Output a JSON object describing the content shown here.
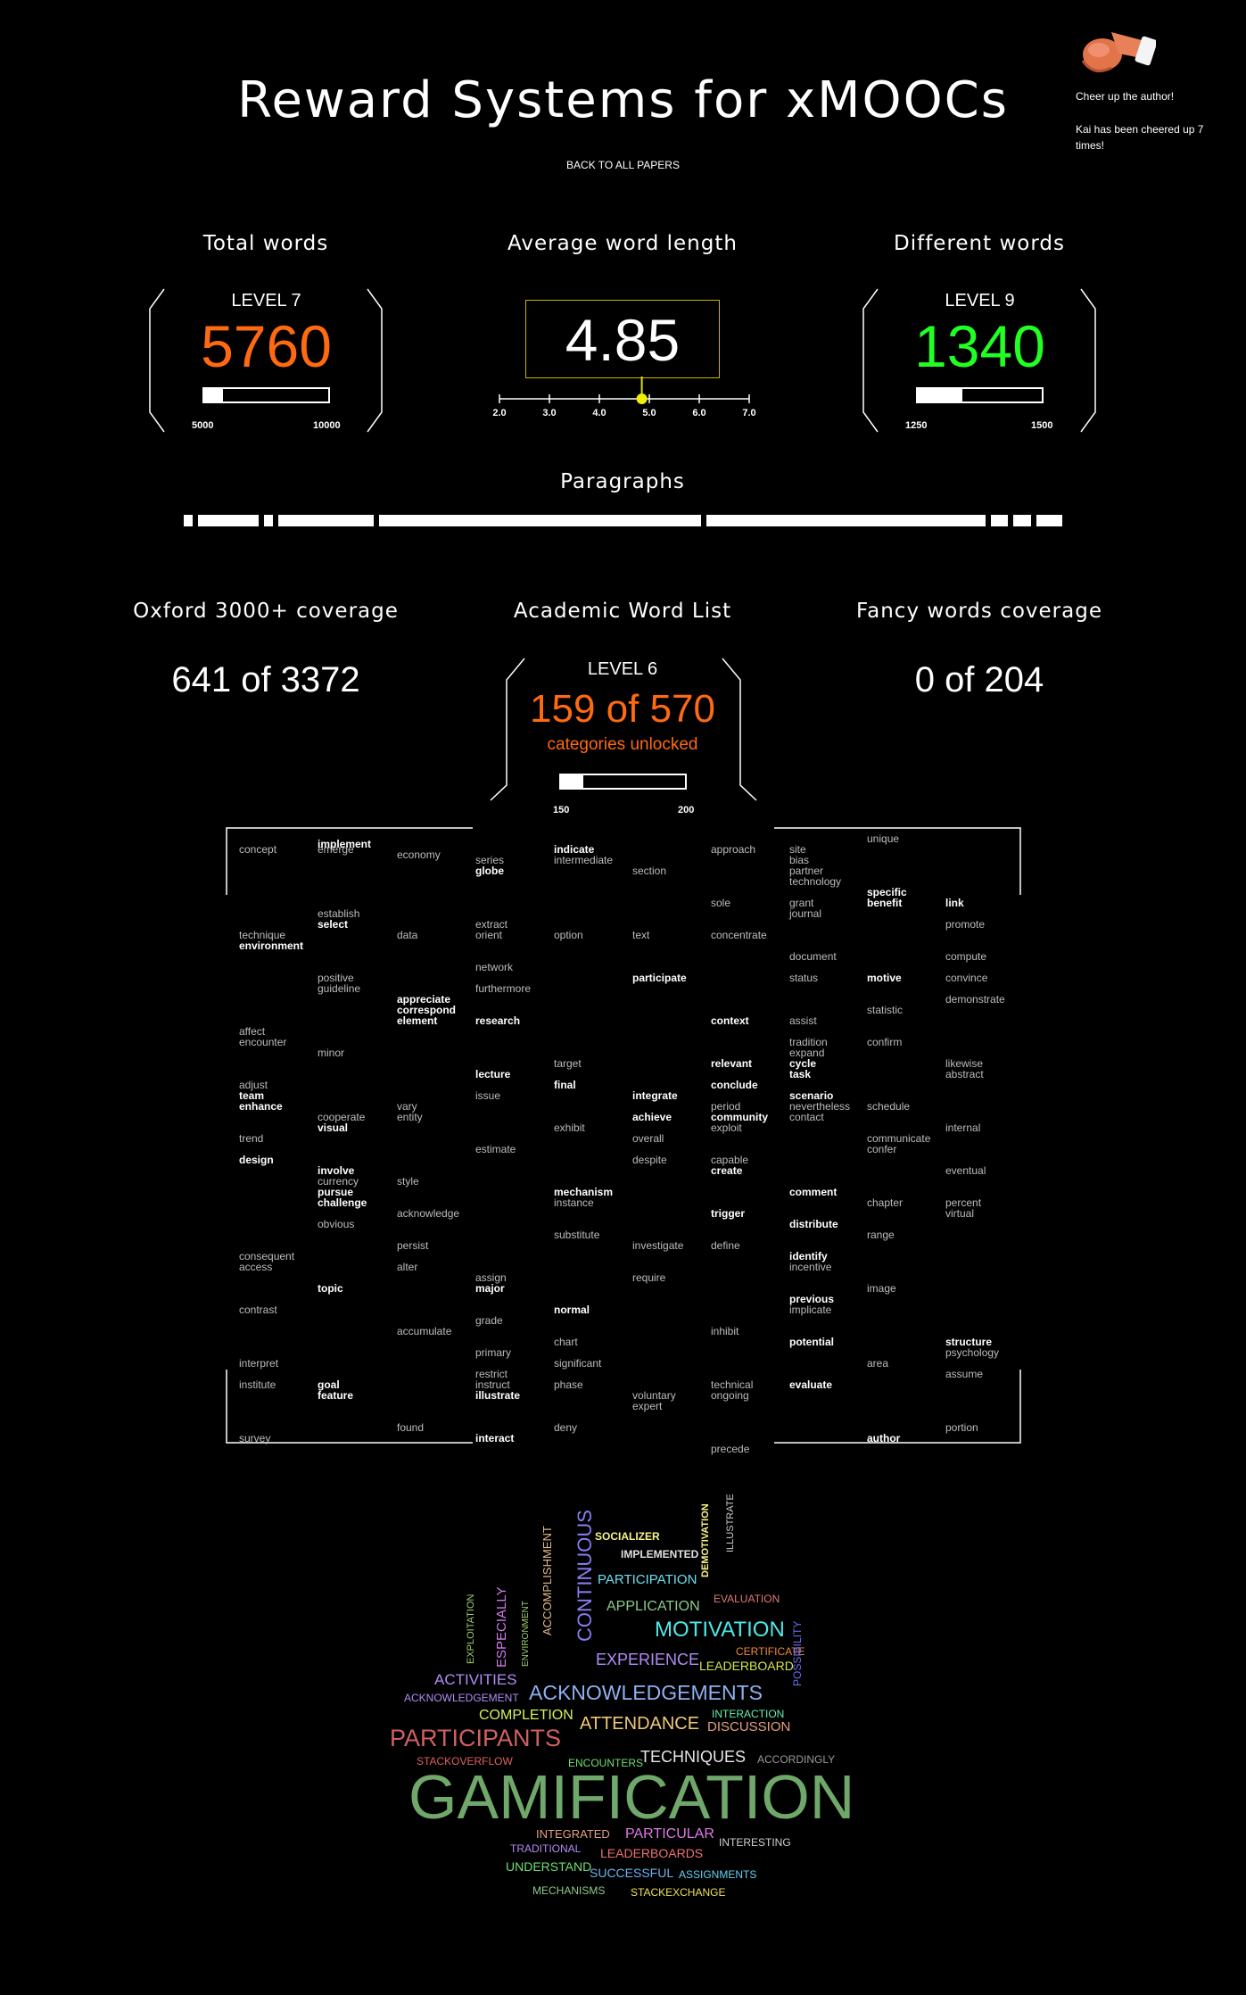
{
  "page": {
    "title": "Reward Systems for xMOOCs",
    "back_link": "BACK TO ALL PAPERS",
    "cheer_label": "Cheer up the author!",
    "cheer_count": "Kai has been cheered up 7 times!"
  },
  "stats": {
    "total_words": {
      "title": "Total words",
      "level": "LEVEL 7",
      "value": "5760",
      "min": "5000",
      "max": "10000",
      "fill": 0.15,
      "color": "#ff6a10"
    },
    "avg_word_length": {
      "title": "Average word length",
      "value": "4.85",
      "ticks": [
        "2.0",
        "3.0",
        "4.0",
        "5.0",
        "6.0",
        "7.0"
      ],
      "marker": 4.85
    },
    "different_words": {
      "title": "Different words",
      "level": "LEVEL 9",
      "value": "1340",
      "min": "1250",
      "max": "1500",
      "fill": 0.36,
      "color": "#22ff22"
    }
  },
  "paragraphs": {
    "title": "Paragraphs",
    "relative_lengths": [
      1,
      7,
      1,
      11,
      37,
      32,
      2,
      2,
      3
    ]
  },
  "coverage": {
    "oxford": {
      "title": "Oxford 3000+ coverage",
      "value": "641 of 3372"
    },
    "awl": {
      "title": "Academic Word List",
      "level": "LEVEL 6",
      "value": "159 of 570",
      "sub": "categories unlocked",
      "min": "150",
      "max": "200",
      "fill": 0.18,
      "color": "#ff6a10"
    },
    "fancy": {
      "title": "Fancy words coverage",
      "value": "0 of 204"
    }
  },
  "word_grid": [
    [
      "concept",
      "",
      0,
      0
    ],
    [
      "implement",
      "hi",
      1,
      -0.5
    ],
    [
      "emerge",
      "",
      1,
      0
    ],
    [
      "economy",
      "",
      2,
      0.5
    ],
    [
      "series",
      "",
      3,
      1
    ],
    [
      "globe",
      "hi",
      3,
      2
    ],
    [
      "indicate",
      "hi",
      4,
      0
    ],
    [
      "intermediate",
      "",
      4,
      1
    ],
    [
      "section",
      "",
      5,
      2
    ],
    [
      "approach",
      "",
      6,
      0
    ],
    [
      "site",
      "",
      7,
      0
    ],
    [
      "bias",
      "",
      7,
      1
    ],
    [
      "partner",
      "",
      7,
      2
    ],
    [
      "technology",
      "",
      7,
      3
    ],
    [
      "unique",
      "",
      8,
      -1
    ],
    [
      "specific",
      "hi",
      8,
      4
    ],
    [
      "benefit",
      "hi",
      8,
      5
    ],
    [
      "link",
      "hi",
      9,
      5
    ],
    [
      "sole",
      "",
      6,
      5
    ],
    [
      "grant",
      "",
      7,
      5
    ],
    [
      "journal",
      "",
      7,
      6
    ],
    [
      "establish",
      "",
      1,
      6
    ],
    [
      "select",
      "hi",
      1,
      7
    ],
    [
      "extract",
      "",
      3,
      7
    ],
    [
      "orient",
      "",
      3,
      8
    ],
    [
      "technique",
      "",
      0,
      8
    ],
    [
      "environment",
      "hi",
      0,
      9
    ],
    [
      "data",
      "",
      2,
      8
    ],
    [
      "option",
      "",
      4,
      8
    ],
    [
      "text",
      "",
      5,
      8
    ],
    [
      "concentrate",
      "",
      6,
      8
    ],
    [
      "promote",
      "",
      9,
      7
    ],
    [
      "document",
      "",
      7,
      10
    ],
    [
      "compute",
      "",
      9,
      10
    ],
    [
      "network",
      "",
      3,
      11
    ],
    [
      "positive",
      "",
      1,
      12
    ],
    [
      "guideline",
      "",
      1,
      13
    ],
    [
      "participate",
      "hi",
      5,
      12
    ],
    [
      "status",
      "",
      7,
      12
    ],
    [
      "motive",
      "hi",
      8,
      12
    ],
    [
      "convince",
      "",
      9,
      12
    ],
    [
      "furthermore",
      "",
      3,
      13
    ],
    [
      "appreciate",
      "hi",
      2,
      14
    ],
    [
      "correspond",
      "hi",
      2,
      15
    ],
    [
      "element",
      "hi",
      2,
      16
    ],
    [
      "demonstrate",
      "",
      9,
      14
    ],
    [
      "statistic",
      "",
      8,
      15
    ],
    [
      "research",
      "hi",
      3,
      16
    ],
    [
      "context",
      "hi",
      6,
      16
    ],
    [
      "assist",
      "",
      7,
      16
    ],
    [
      "affect",
      "",
      0,
      17
    ],
    [
      "encounter",
      "",
      0,
      18
    ],
    [
      "tradition",
      "",
      7,
      18
    ],
    [
      "expand",
      "",
      7,
      19
    ],
    [
      "confirm",
      "",
      8,
      18
    ],
    [
      "minor",
      "",
      1,
      19
    ],
    [
      "cycle",
      "hi",
      7,
      20
    ],
    [
      "task",
      "hi",
      7,
      21
    ],
    [
      "target",
      "",
      4,
      20
    ],
    [
      "relevant",
      "hi",
      6,
      20
    ],
    [
      "likewise",
      "",
      9,
      20
    ],
    [
      "abstract",
      "",
      9,
      21
    ],
    [
      "lecture",
      "hi",
      3,
      21
    ],
    [
      "adjust",
      "",
      0,
      22
    ],
    [
      "final",
      "hi",
      4,
      22
    ],
    [
      "conclude",
      "hi",
      6,
      22
    ],
    [
      "team",
      "hi",
      0,
      23
    ],
    [
      "enhance",
      "hi",
      0,
      24
    ],
    [
      "issue",
      "",
      3,
      23
    ],
    [
      "integrate",
      "hi",
      5,
      23
    ],
    [
      "scenario",
      "hi",
      7,
      23
    ],
    [
      "nevertheless",
      "",
      7,
      24
    ],
    [
      "contact",
      "",
      7,
      25
    ],
    [
      "vary",
      "",
      2,
      24
    ],
    [
      "entity",
      "",
      2,
      25
    ],
    [
      "period",
      "",
      6,
      24
    ],
    [
      "schedule",
      "",
      8,
      24
    ],
    [
      "cooperate",
      "",
      1,
      25
    ],
    [
      "visual",
      "hi",
      1,
      26
    ],
    [
      "achieve",
      "hi",
      5,
      25
    ],
    [
      "community",
      "hi",
      6,
      25
    ],
    [
      "exploit",
      "",
      6,
      26
    ],
    [
      "exhibit",
      "",
      4,
      26
    ],
    [
      "internal",
      "",
      9,
      26
    ],
    [
      "trend",
      "",
      0,
      27
    ],
    [
      "overall",
      "",
      5,
      27
    ],
    [
      "communicate",
      "",
      8,
      27
    ],
    [
      "confer",
      "",
      8,
      28
    ],
    [
      "estimate",
      "",
      3,
      28
    ],
    [
      "design",
      "hi",
      0,
      29
    ],
    [
      "despite",
      "",
      5,
      29
    ],
    [
      "capable",
      "",
      6,
      29
    ],
    [
      "create",
      "hi",
      6,
      30
    ],
    [
      "involve",
      "hi",
      1,
      30
    ],
    [
      "currency",
      "",
      1,
      31
    ],
    [
      "pursue",
      "hi",
      1,
      32
    ],
    [
      "challenge",
      "hi",
      1,
      33
    ],
    [
      "style",
      "",
      2,
      31
    ],
    [
      "eventual",
      "",
      9,
      30
    ],
    [
      "mechanism",
      "hi",
      4,
      32
    ],
    [
      "instance",
      "",
      4,
      33
    ],
    [
      "comment",
      "hi",
      7,
      32
    ],
    [
      "chapter",
      "",
      8,
      33
    ],
    [
      "percent",
      "",
      9,
      33
    ],
    [
      "virtual",
      "",
      9,
      34
    ],
    [
      "acknowledge",
      "",
      2,
      34
    ],
    [
      "trigger",
      "hi",
      6,
      34
    ],
    [
      "obvious",
      "",
      1,
      35
    ],
    [
      "distribute",
      "hi",
      7,
      35
    ],
    [
      "substitute",
      "",
      4,
      36
    ],
    [
      "range",
      "",
      8,
      36
    ],
    [
      "persist",
      "",
      2,
      37
    ],
    [
      "investigate",
      "",
      5,
      37
    ],
    [
      "define",
      "",
      6,
      37
    ],
    [
      "consequent",
      "",
      0,
      38
    ],
    [
      "access",
      "",
      0,
      39
    ],
    [
      "identify",
      "hi",
      7,
      38
    ],
    [
      "incentive",
      "",
      7,
      39
    ],
    [
      "alter",
      "",
      2,
      39
    ],
    [
      "assign",
      "",
      3,
      40
    ],
    [
      "major",
      "hi",
      3,
      41
    ],
    [
      "require",
      "",
      5,
      40
    ],
    [
      "topic",
      "hi",
      1,
      41
    ],
    [
      "image",
      "",
      8,
      41
    ],
    [
      "previous",
      "hi",
      7,
      42
    ],
    [
      "implicate",
      "",
      7,
      43
    ],
    [
      "contrast",
      "",
      0,
      43
    ],
    [
      "normal",
      "hi",
      4,
      43
    ],
    [
      "grade",
      "",
      3,
      44
    ],
    [
      "accumulate",
      "",
      2,
      45
    ],
    [
      "inhibit",
      "",
      6,
      45
    ],
    [
      "chart",
      "",
      4,
      46
    ],
    [
      "potential",
      "hi",
      7,
      46
    ],
    [
      "structure",
      "hi",
      9,
      46
    ],
    [
      "psychology",
      "",
      9,
      47
    ],
    [
      "primary",
      "",
      3,
      47
    ],
    [
      "significant",
      "",
      4,
      48
    ],
    [
      "interpret",
      "",
      0,
      48
    ],
    [
      "area",
      "",
      8,
      48
    ],
    [
      "restrict",
      "",
      3,
      49
    ],
    [
      "assume",
      "",
      9,
      49
    ],
    [
      "institute",
      "",
      0,
      50
    ],
    [
      "goal",
      "hi",
      1,
      50
    ],
    [
      "feature",
      "hi",
      1,
      51
    ],
    [
      "instruct",
      "",
      3,
      50
    ],
    [
      "illustrate",
      "hi",
      3,
      51
    ],
    [
      "phase",
      "",
      4,
      50
    ],
    [
      "technical",
      "",
      6,
      50
    ],
    [
      "ongoing",
      "",
      6,
      51
    ],
    [
      "evaluate",
      "hi",
      7,
      50
    ],
    [
      "voluntary",
      "",
      5,
      51
    ],
    [
      "expert",
      "",
      5,
      52
    ],
    [
      "found",
      "",
      2,
      54
    ],
    [
      "deny",
      "",
      4,
      54
    ],
    [
      "portion",
      "",
      9,
      54
    ],
    [
      "survey",
      "",
      0,
      55
    ],
    [
      "interact",
      "hi",
      3,
      55
    ],
    [
      "author",
      "hi",
      8,
      55
    ],
    [
      "precede",
      "",
      6,
      56
    ]
  ],
  "word_cloud": [
    {
      "text": "SOCIALIZER",
      "color": "#f5f58a",
      "size": 12,
      "weight": "bold",
      "dir": "h"
    },
    {
      "text": "IMPLEMENTED",
      "color": "#e0e0e0",
      "size": 12,
      "weight": "bold",
      "dir": "h"
    },
    {
      "text": "DEMOTIVATION",
      "color": "#f5f58a",
      "size": 11,
      "weight": "bold",
      "dir": "v"
    },
    {
      "text": "ILLUSTRATE",
      "color": "#cfcfcf",
      "size": 11,
      "weight": "normal",
      "dir": "v"
    },
    {
      "text": "PARTICIPATION",
      "color": "#66e0f0",
      "size": 15,
      "weight": "normal",
      "dir": "h"
    },
    {
      "text": "CONTINUOUS",
      "color": "#8a7ff5",
      "size": 22,
      "weight": "normal",
      "dir": "v"
    },
    {
      "text": "ACCOMPLISHMENT",
      "color": "#e2b98a",
      "size": 13,
      "weight": "normal",
      "dir": "v"
    },
    {
      "text": "ESPECIALLY",
      "color": "#d07cf0",
      "size": 15,
      "weight": "normal",
      "dir": "v"
    },
    {
      "text": "EXPLOITATION",
      "color": "#a0cf70",
      "size": 11,
      "weight": "normal",
      "dir": "v"
    },
    {
      "text": "ENVIRONMENT",
      "color": "#a0cf70",
      "size": 10,
      "weight": "normal",
      "dir": "v"
    },
    {
      "text": "APPLICATION",
      "color": "#8ec98e",
      "size": 16,
      "weight": "normal",
      "dir": "h"
    },
    {
      "text": "EVALUATION",
      "color": "#e07a7a",
      "size": 12,
      "weight": "normal",
      "dir": "h"
    },
    {
      "text": "MOTIVATION",
      "color": "#4fe8e8",
      "size": 24,
      "weight": "normal",
      "dir": "h"
    },
    {
      "text": "CERTIFICATE",
      "color": "#f08a3a",
      "size": 12,
      "weight": "normal",
      "dir": "h"
    },
    {
      "text": "EXPERIENCE",
      "color": "#b28cf5",
      "size": 18,
      "weight": "normal",
      "dir": "h"
    },
    {
      "text": "LEADERBOARD",
      "color": "#d6e84a",
      "size": 14,
      "weight": "normal",
      "dir": "h"
    },
    {
      "text": "ACTIVITIES",
      "color": "#b28cf5",
      "size": 17,
      "weight": "normal",
      "dir": "h"
    },
    {
      "text": "ACKNOWLEDGEMENT",
      "color": "#b28cf5",
      "size": 12,
      "weight": "normal",
      "dir": "h"
    },
    {
      "text": "ACKNOWLEDGEMENTS",
      "color": "#8fb0f0",
      "size": 23,
      "weight": "normal",
      "dir": "h"
    },
    {
      "text": "POSSIBILITY",
      "color": "#6b6bf5",
      "size": 12,
      "weight": "normal",
      "dir": "v"
    },
    {
      "text": "COMPLETION",
      "color": "#d6f05a",
      "size": 16,
      "weight": "normal",
      "dir": "h"
    },
    {
      "text": "INTERACTION",
      "color": "#66f0b0",
      "size": 12,
      "weight": "normal",
      "dir": "h"
    },
    {
      "text": "ATTENDANCE",
      "color": "#f0c87a",
      "size": 20,
      "weight": "normal",
      "dir": "h"
    },
    {
      "text": "DISCUSSION",
      "color": "#e2a080",
      "size": 15,
      "weight": "normal",
      "dir": "h"
    },
    {
      "text": "PARTICIPANTS",
      "color": "#d06060",
      "size": 27,
      "weight": "normal",
      "dir": "h"
    },
    {
      "text": "STACKOVERFLOW",
      "color": "#e06060",
      "size": 12,
      "weight": "normal",
      "dir": "h"
    },
    {
      "text": "ENCOUNTERS",
      "color": "#6ee070",
      "size": 12,
      "weight": "normal",
      "dir": "h"
    },
    {
      "text": "TECHNIQUES",
      "color": "#e6e6e6",
      "size": 18,
      "weight": "normal",
      "dir": "h"
    },
    {
      "text": "ACCORDINGLY",
      "color": "#9a9a9a",
      "size": 12,
      "weight": "normal",
      "dir": "h"
    },
    {
      "text": "GAMIFICATION",
      "color": "#6fa86a",
      "size": 70,
      "weight": "normal",
      "dir": "h"
    },
    {
      "text": "INTEGRATED",
      "color": "#e2a080",
      "size": 13,
      "weight": "normal",
      "dir": "h"
    },
    {
      "text": "PARTICULAR",
      "color": "#e07ae8",
      "size": 16,
      "weight": "normal",
      "dir": "h"
    },
    {
      "text": "INTERESTING",
      "color": "#d0d0d0",
      "size": 12,
      "weight": "normal",
      "dir": "h"
    },
    {
      "text": "TRADITIONAL",
      "color": "#b28cf5",
      "size": 12,
      "weight": "normal",
      "dir": "h"
    },
    {
      "text": "LEADERBOARDS",
      "color": "#f07070",
      "size": 14,
      "weight": "normal",
      "dir": "h"
    },
    {
      "text": "UNDERSTAND",
      "color": "#6ee070",
      "size": 14,
      "weight": "normal",
      "dir": "h"
    },
    {
      "text": "SUCCESSFUL",
      "color": "#6ab4f0",
      "size": 14,
      "weight": "normal",
      "dir": "h"
    },
    {
      "text": "ASSIGNMENTS",
      "color": "#66d0f0",
      "size": 12,
      "weight": "normal",
      "dir": "h"
    },
    {
      "text": "MECHANISMS",
      "color": "#8ec98e",
      "size": 12,
      "weight": "normal",
      "dir": "h"
    },
    {
      "text": "STACKEXCHANGE",
      "color": "#f0e050",
      "size": 12,
      "weight": "normal",
      "dir": "h"
    }
  ]
}
